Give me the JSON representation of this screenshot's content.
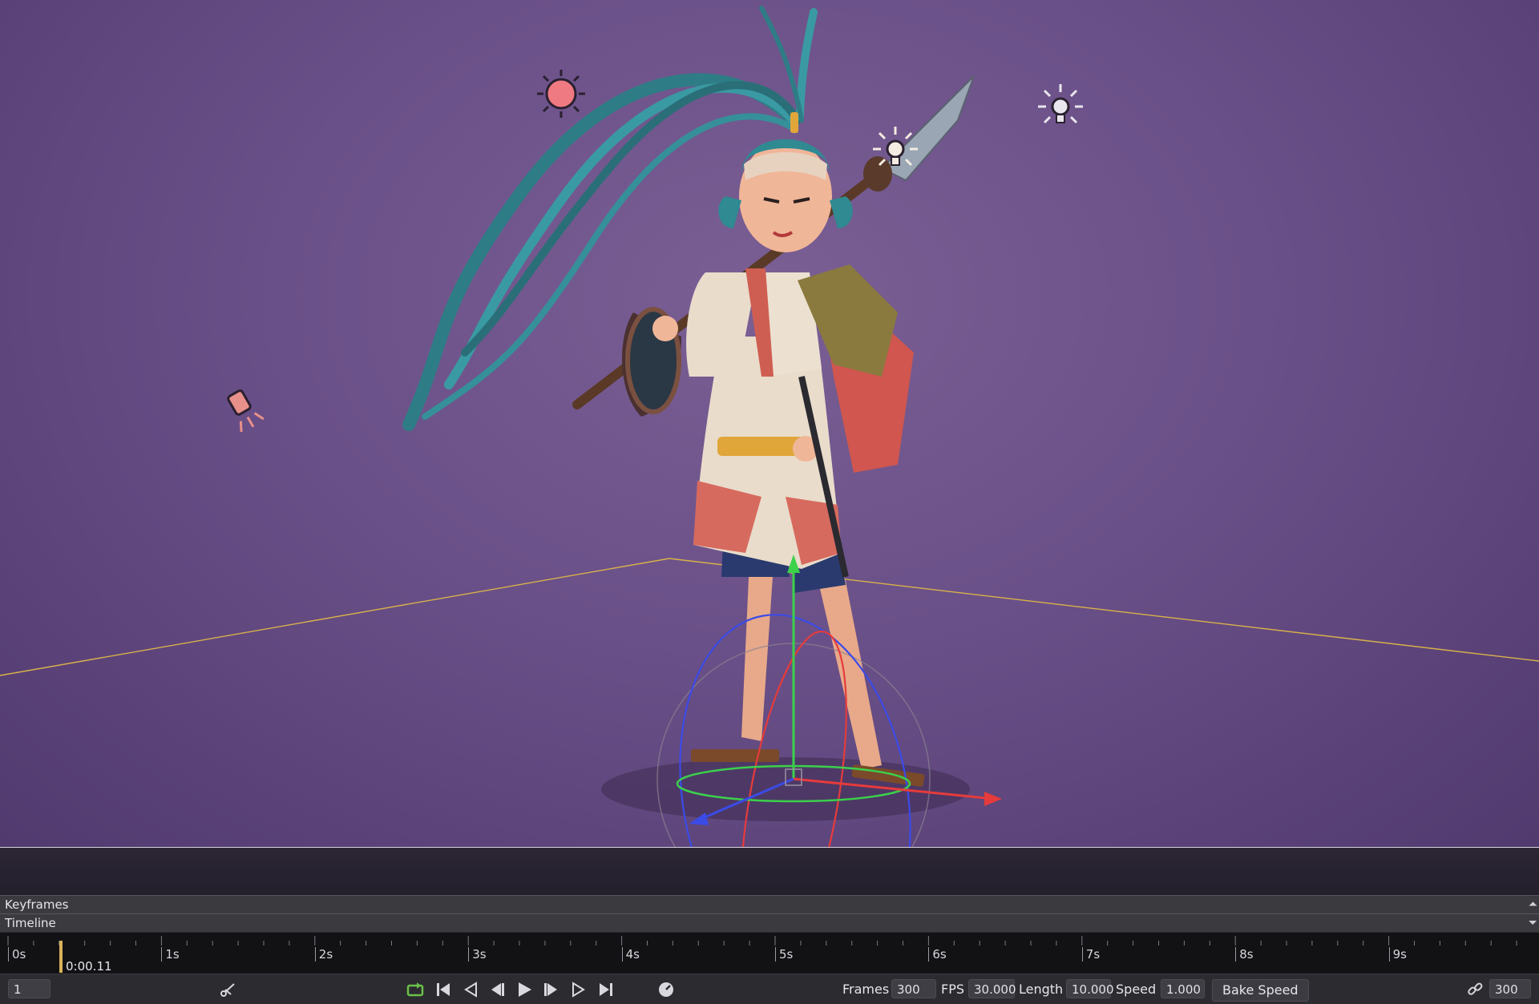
{
  "panels": {
    "keyframes": "Keyframes",
    "timeline": "Timeline"
  },
  "timeline": {
    "tick_labels": [
      "0s",
      "1s",
      "2s",
      "3s",
      "4s",
      "5s",
      "6s",
      "7s",
      "8s",
      "9s"
    ],
    "playhead_time": "0:00.11"
  },
  "bottom_bar": {
    "current_frame": "1",
    "frames_label": "Frames",
    "frames_value": "300",
    "fps_label": "FPS",
    "fps_value": "30.000",
    "length_label": "Length",
    "length_value": "10.000",
    "speed_label": "Speed",
    "speed_value": "1.000",
    "bake_speed_label": "Bake Speed",
    "end_frame": "300"
  },
  "colors": {
    "viewport_bg": "#6a5088",
    "gizmo_x": "#e63b3b",
    "gizmo_y": "#3bd14b",
    "gizmo_z": "#3b4be6",
    "floor_outline": "#d8b24a",
    "playhead": "#d9b25a",
    "play_controls_accent": "#6bc24a"
  },
  "icons": [
    "sun-light-icon",
    "point-light-icon",
    "spot-light-icon",
    "scissors-icon",
    "loop-icon",
    "go-to-start-icon",
    "prev-key-icon",
    "step-back-icon",
    "play-icon",
    "step-forward-icon",
    "next-key-icon",
    "go-to-end-icon",
    "speed-dial-icon",
    "link-icon"
  ]
}
